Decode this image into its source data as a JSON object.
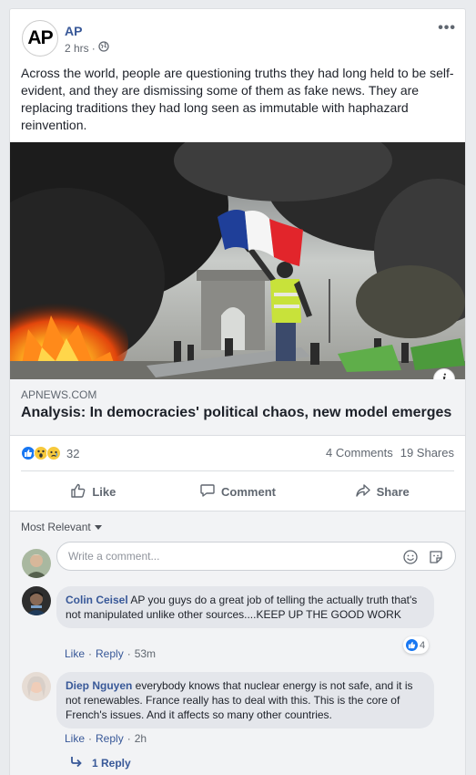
{
  "post": {
    "page_name": "AP",
    "logo_text": "AP",
    "time": "2 hrs",
    "text": "Across the world, people are questioning truths they had long held to be self-evident, and they are dismissing some of them as fake news. They are replacing traditions they had long seen as immutable with haphazard reinvention.",
    "more_label": "•••"
  },
  "link": {
    "domain": "APNEWS.COM",
    "title": "Analysis: In democracies' political chaos, new model emerges",
    "info_label": "i"
  },
  "engagement": {
    "reaction_icons": [
      "like-icon",
      "wow-icon",
      "sad-icon"
    ],
    "reaction_count": "32",
    "comments": "4 Comments",
    "shares": "19 Shares"
  },
  "actions": {
    "like": "Like",
    "comment": "Comment",
    "share": "Share"
  },
  "comments": {
    "sort_label": "Most Relevant",
    "placeholder": "Write a comment...",
    "items": [
      {
        "author": "Colin Ceisel",
        "text": " AP you guys do a great job of telling the actually truth that's not manipulated unlike other sources....KEEP UP THE GOOD WORK",
        "like": "Like",
        "reply": "Reply",
        "time": "53m",
        "reaction_count": "4"
      },
      {
        "author": "Diep Nguyen",
        "text": " everybody knows that nuclear energy is not safe, and it is not renewables. France really has to deal with this. This is the core of French's issues. And it affects so many other countries.",
        "like": "Like",
        "reply": "Reply",
        "time": "2h"
      }
    ],
    "replies_label": "1 Reply"
  },
  "colors": {
    "link_blue": "#385898",
    "like_blue": "#1877f2",
    "muted": "#606770"
  }
}
